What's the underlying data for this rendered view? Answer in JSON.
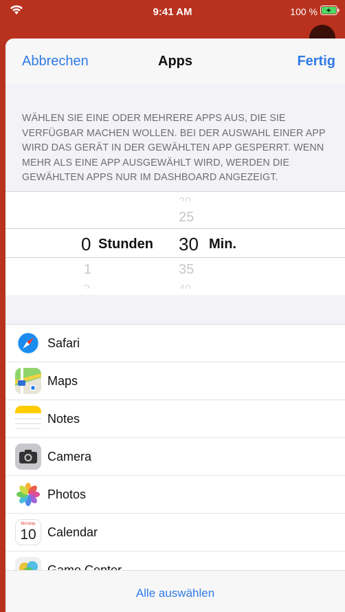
{
  "status_bar": {
    "time": "9:41 AM",
    "battery": "100 %"
  },
  "nav": {
    "cancel": "Abbrechen",
    "title": "Apps",
    "done": "Fertig"
  },
  "description": "WÄHLEN SIE EINE ODER MEHRERE APPS AUS, DIE SIE VERFÜGBAR MACHEN WOLLEN.  BEI DER AUSWAHL EINER APP WIRD DAS GERÄT IN DER GEWÄHLTEN APP GESPERRT. WENN MEHR ALS EINE APP AUSGEWÄHLT WIRD, WERDEN DIE GEWÄHLTEN APPS NUR IM DASHBOARD ANGEZEIGT.",
  "picker": {
    "hours": {
      "selected": "0",
      "next": "1",
      "unit": "Stunden"
    },
    "minutes": {
      "prev": "25",
      "selected": "30",
      "next": "35",
      "unit": "Min."
    }
  },
  "apps": [
    {
      "name": "Safari",
      "icon": "safari-icon"
    },
    {
      "name": "Maps",
      "icon": "maps-icon"
    },
    {
      "name": "Notes",
      "icon": "notes-icon"
    },
    {
      "name": "Camera",
      "icon": "camera-icon"
    },
    {
      "name": "Photos",
      "icon": "photos-icon"
    },
    {
      "name": "Calendar",
      "icon": "calendar-icon",
      "icon_day": "Monday",
      "icon_date": "10"
    },
    {
      "name": "Game Center",
      "icon": "game-center-icon"
    }
  ],
  "footer": {
    "select_all": "Alle auswählen"
  },
  "colors": {
    "accent": "#2f7ae5",
    "background_app": "#b8321e",
    "sheet": "#f2f2f7"
  }
}
